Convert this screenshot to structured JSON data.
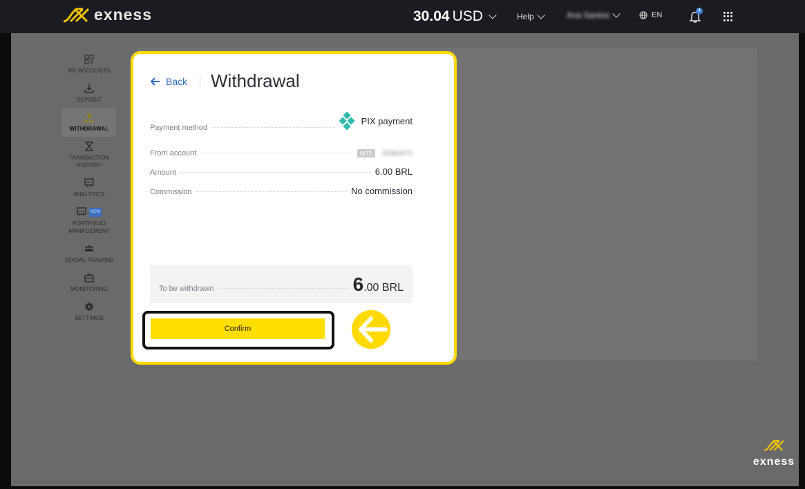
{
  "header": {
    "brand": "exness",
    "balance_amount": "30.04",
    "balance_currency": "USD",
    "help_label": "Help",
    "user_name": "Ana Santos",
    "language": "EN",
    "notification_count": "4"
  },
  "sidebar": {
    "items": [
      {
        "label": "MY ACCOUNTS",
        "icon": "accounts-icon"
      },
      {
        "label": "DEPOSIT",
        "icon": "deposit-icon"
      },
      {
        "label": "WITHDRAWAL",
        "icon": "withdrawal-icon"
      },
      {
        "label": "TRANSACTION HISTORY",
        "icon": "hourglass-icon"
      },
      {
        "label": "ANALYTICS",
        "icon": "analytics-icon"
      },
      {
        "label": "PORTFOLIO MANAGEMENT",
        "icon": "portfolio-icon",
        "badge": "NEW"
      },
      {
        "label": "SOCIAL TRADING",
        "icon": "social-icon"
      },
      {
        "label": "MONITORING",
        "icon": "briefcase-icon"
      },
      {
        "label": "SETTINGS",
        "icon": "gear-icon"
      }
    ],
    "active_index": 2
  },
  "card": {
    "back_label": "Back",
    "title": "Withdrawal",
    "payment_method_label": "Payment method",
    "payment_method_value": "PIX payment",
    "from_account_label": "From account",
    "account_type": "MT5",
    "account_number": "25382672",
    "amount_label": "Amount",
    "amount_value": "6.00 BRL",
    "commission_label": "Commission",
    "commission_value": "No commission",
    "to_be_withdrawn_label": "To be withdrawn",
    "to_be_withdrawn_int": "6",
    "to_be_withdrawn_rest": ".00 BRL",
    "confirm_label": "Confirm"
  },
  "corner_brand": "exness",
  "colors": {
    "accent_yellow": "#ffd900",
    "link_blue": "#2f6ec0",
    "pix_teal": "#32bcad"
  }
}
